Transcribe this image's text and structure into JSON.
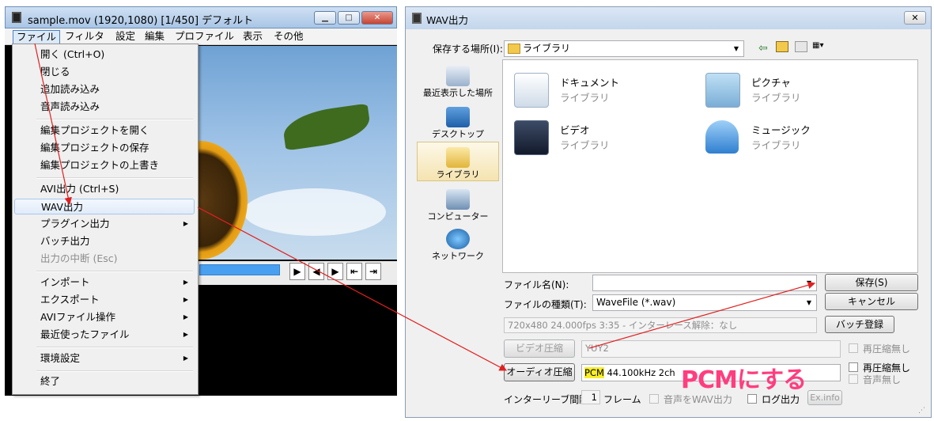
{
  "avi": {
    "title": "sample.mov (1920,1080)  [1/450]  デフォルト",
    "menubar": [
      "ファイル",
      "フィルタ",
      "設定",
      "編集",
      "プロファイル",
      "表示",
      "その他"
    ]
  },
  "file_menu": {
    "items": [
      {
        "label": "開く (Ctrl+O)"
      },
      {
        "label": "閉じる"
      },
      {
        "label": "追加読み込み"
      },
      {
        "label": "音声読み込み"
      },
      {
        "label": "編集プロジェクトを開く"
      },
      {
        "label": "編集プロジェクトの保存"
      },
      {
        "label": "編集プロジェクトの上書き"
      },
      {
        "label": "AVI出力 (Ctrl+S)"
      },
      {
        "label": "WAV出力"
      },
      {
        "label": "プラグイン出力"
      },
      {
        "label": "バッチ出力"
      },
      {
        "label": "出力の中断 (Esc)"
      },
      {
        "label": "インポート"
      },
      {
        "label": "エクスポート"
      },
      {
        "label": "AVIファイル操作"
      },
      {
        "label": "最近使ったファイル"
      },
      {
        "label": "環境設定"
      },
      {
        "label": "終了"
      }
    ]
  },
  "dialog": {
    "title": "WAV出力",
    "save_in_label": "保存する場所(I):",
    "save_in_value": "ライブラリ",
    "places": [
      "最近表示した場所",
      "デスクトップ",
      "ライブラリ",
      "コンピューター",
      "ネットワーク"
    ],
    "libraries": [
      {
        "name": "ドキュメント",
        "sub": "ライブラリ"
      },
      {
        "name": "ピクチャ",
        "sub": "ライブラリ"
      },
      {
        "name": "ビデオ",
        "sub": "ライブラリ"
      },
      {
        "name": "ミュージック",
        "sub": "ライブラリ"
      }
    ],
    "filename_label": "ファイル名(N):",
    "filename_value": "",
    "filetype_label": "ファイルの種類(T):",
    "filetype_value": "WaveFile (*.wav)",
    "save_button": "保存(S)",
    "cancel_button": "キャンセル",
    "video_info": "720x480  24.000fps  3:35  -  インターレース解除：なし",
    "batch_button": "バッチ登録",
    "video_compress_button": "ビデオ圧縮",
    "video_codec": "YUY2",
    "recompress_off_label": "再圧縮無し",
    "audio_compress_button": "オーディオ圧縮",
    "audio_codec_pcm": "PCM",
    "audio_codec_rest": " 44.100kHz  2ch",
    "recompress_off_label2": "再圧縮無し",
    "no_audio_label": "音声無し",
    "interleave_label": "インターリーブ間隔 :",
    "interleave_value": "1",
    "frame_label": "フレーム",
    "audio_wav_label": "音声をWAV出力",
    "log_label": "ログ出力",
    "exinfo_button": "Ex.info"
  },
  "annotation": "PCMにする"
}
